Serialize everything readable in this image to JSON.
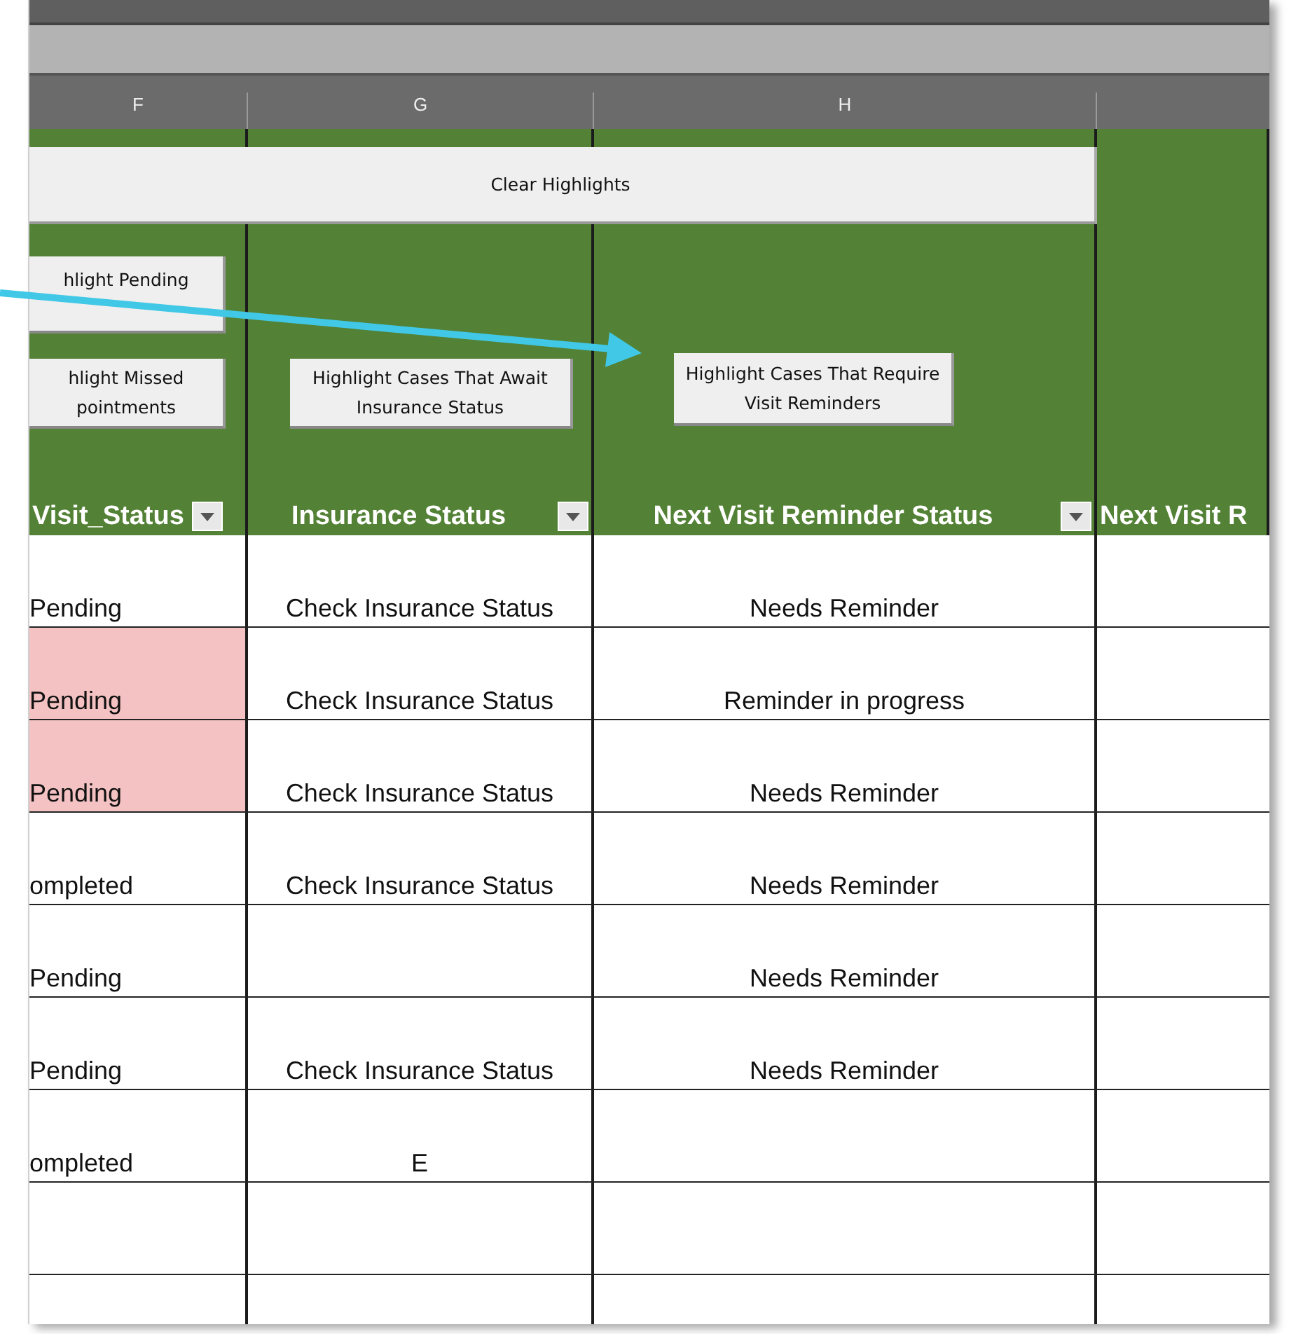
{
  "columns": [
    {
      "letter": "F",
      "header": "Visit_Status",
      "filter": true,
      "buttons": [
        {
          "lines": [
            "hlight Pending"
          ]
        },
        {
          "lines": [
            "hlight Missed",
            "pointments"
          ]
        }
      ]
    },
    {
      "letter": "G",
      "header": "Insurance Status",
      "filter": true,
      "buttons": [
        {
          "lines": [
            "Highlight Cases That Await",
            "Insurance Status"
          ]
        }
      ]
    },
    {
      "letter": "H",
      "header": "Next Visit Reminder Status",
      "filter": true,
      "buttons": [
        {
          "lines": [
            "Highlight Cases That Require",
            "Visit Reminders"
          ]
        }
      ]
    },
    {
      "header": "Next Visit R"
    }
  ],
  "clear_button": {
    "label": "Clear Highlights"
  },
  "rows": [
    {
      "visit_status": "Pending",
      "visit_highlighted": false,
      "insurance_status": "Check Insurance Status",
      "reminder_status": "Needs Reminder"
    },
    {
      "visit_status": "Pending",
      "visit_highlighted": true,
      "insurance_status": "Check Insurance Status",
      "reminder_status": "Reminder in progress"
    },
    {
      "visit_status": "Pending",
      "visit_highlighted": true,
      "insurance_status": "Check Insurance Status",
      "reminder_status": "Needs Reminder"
    },
    {
      "visit_status": "ompleted",
      "visit_highlighted": false,
      "insurance_status": "Check Insurance Status",
      "reminder_status": "Needs Reminder"
    },
    {
      "visit_status": "Pending",
      "visit_highlighted": false,
      "reminder_status": "Needs Reminder"
    },
    {
      "visit_status": "Pending",
      "visit_highlighted": false,
      "insurance_status": "Check Insurance Status",
      "reminder_status": "Needs Reminder"
    },
    {
      "visit_status": "ompleted",
      "visit_highlighted": false,
      "insurance_status": "E"
    },
    {
      "visit_highlighted": false
    },
    {
      "visit_highlighted": false
    }
  ]
}
